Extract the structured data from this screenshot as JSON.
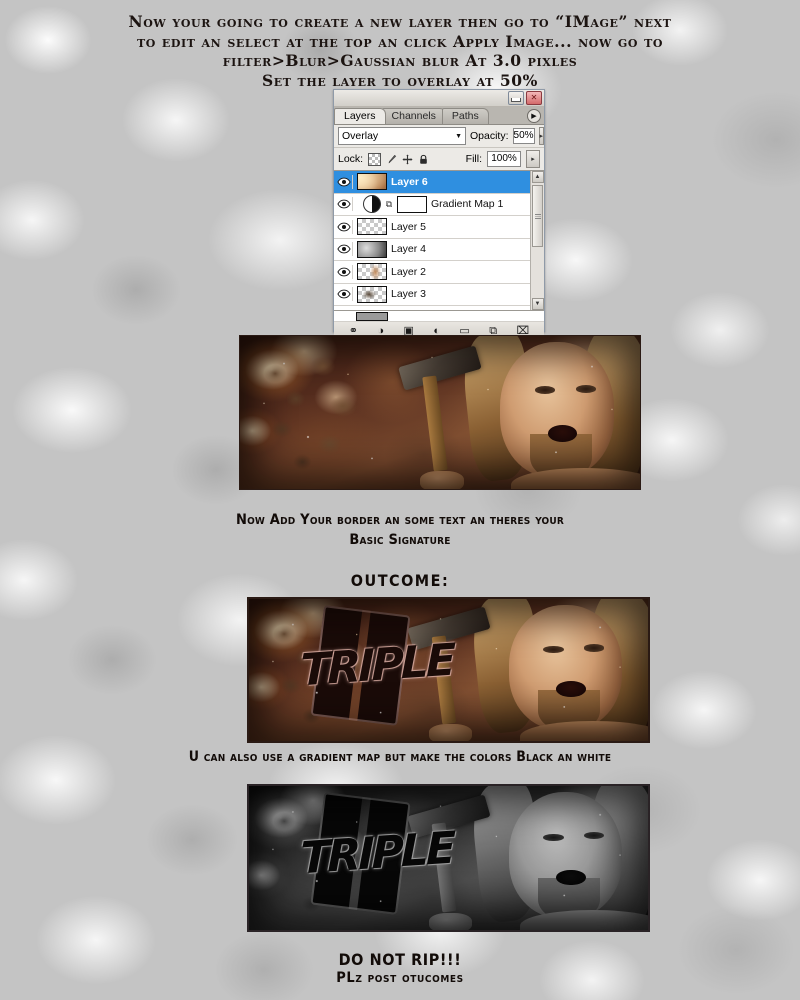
{
  "intro": {
    "line1": "Now your going to create a new layer then go to  “IMage”  next",
    "line2": "to edit an select at the top an click Apply Image... now go to",
    "line3": "filter>Blur>Gaussian blur At 3.0 pixles",
    "line4": "Set the layer to overlay at 50%"
  },
  "photoshop": {
    "window_buttons": {
      "minimize": "—",
      "close": "✕"
    },
    "tabs": [
      {
        "label": "Layers",
        "active": true
      },
      {
        "label": "Channels",
        "active": false
      },
      {
        "label": "Paths",
        "active": false
      }
    ],
    "panel_menu_icon": "▶",
    "blend_mode": "Overlay",
    "blend_arrow": "▼",
    "opacity_label": "Opacity:",
    "opacity_value": "50%",
    "fill_label": "Fill:",
    "fill_value": "100%",
    "spinner_arrow": "▸",
    "lock_label": "Lock:",
    "lock_icons": [
      "transparency-checker-icon",
      "brush-icon",
      "move-icon",
      "padlock-icon"
    ],
    "layers": [
      {
        "name": "Layer 6",
        "selected": true,
        "type": "image",
        "visible": true
      },
      {
        "name": "Gradient Map 1",
        "selected": false,
        "type": "adjustment",
        "visible": true
      },
      {
        "name": "Layer 5",
        "selected": false,
        "type": "checker",
        "visible": true
      },
      {
        "name": "Layer 4",
        "selected": false,
        "type": "clouds",
        "visible": true
      },
      {
        "name": "Layer 2",
        "selected": false,
        "type": "figure",
        "visible": true
      },
      {
        "name": "Layer 3",
        "selected": false,
        "type": "figure2",
        "visible": true
      }
    ],
    "eye_icon": "◉",
    "link_icon": "⧉",
    "scroll_up": "▲",
    "scroll_down": "▼",
    "bottom_icons": [
      {
        "name": "link-layers-icon",
        "glyph": "⚭"
      },
      {
        "name": "layer-style-icon",
        "glyph": "◑"
      },
      {
        "name": "layer-mask-icon",
        "glyph": "▣"
      },
      {
        "name": "new-adjustment-layer-icon",
        "glyph": "◐"
      },
      {
        "name": "new-group-icon",
        "glyph": "▭"
      },
      {
        "name": "new-layer-icon",
        "glyph": "⧉"
      },
      {
        "name": "delete-layer-icon",
        "glyph": "⌧"
      }
    ]
  },
  "signatures": {
    "sig1": {
      "alt": "Triple H sledgehammer fiery signature, no border",
      "graffiti": ""
    },
    "sig2": {
      "alt": "Triple H signature with border and graffiti text",
      "graffiti": "TRIPLE"
    },
    "sig3": {
      "alt": "Triple H signature with black and white gradient map",
      "graffiti": "TRIPLE"
    }
  },
  "captions": {
    "cap1_line1": "Now Add Your border an some text an theres your",
    "cap1_line2": "Basic Signature",
    "outcome": "OUTCOME:",
    "cap3": "U can also use a gradient map but make the colors Black an white",
    "cap4_line1": "DO NOT RIP!!!",
    "cap4_line2": "PLz post otucomes"
  },
  "colors": {
    "background": "#c4c4c4",
    "text": "#120b08",
    "selection_blue": "#2f8fe0",
    "panel_face": "#eceae6",
    "close_red": "#d46a6a"
  }
}
